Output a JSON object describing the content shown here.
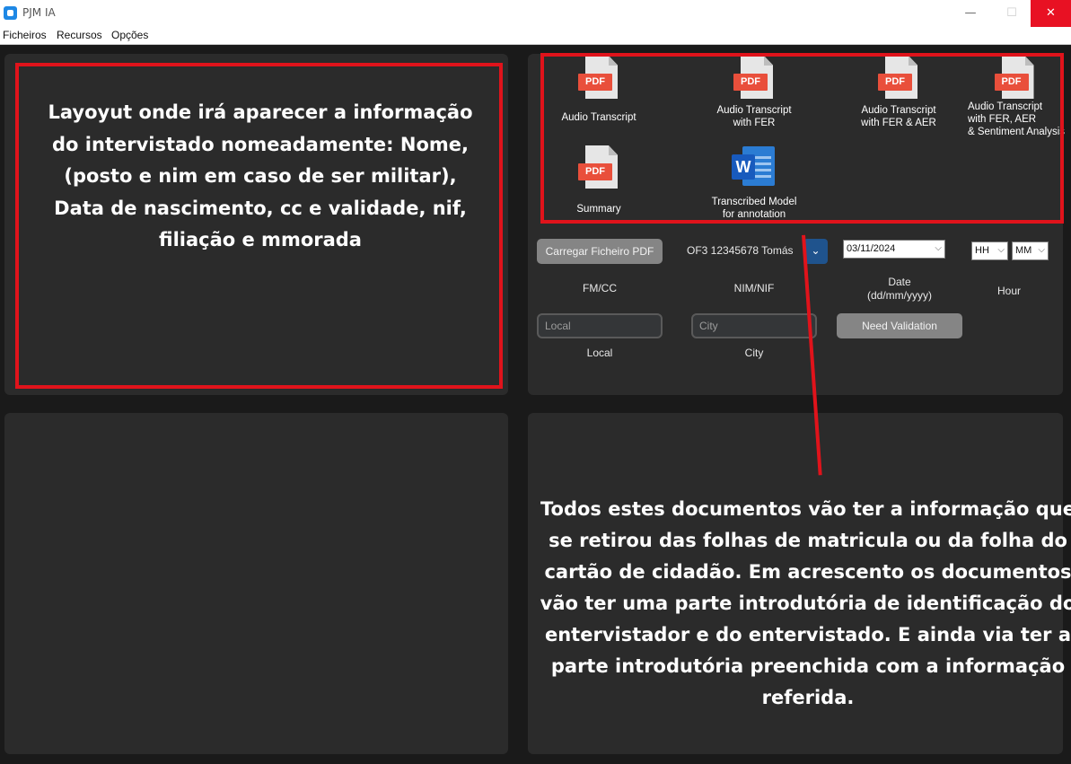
{
  "window": {
    "title": "PJM IA",
    "minimize": "—",
    "maximize": "☐",
    "close": "✕"
  },
  "menu": [
    "Ficheiros",
    "Recursos",
    "Opções"
  ],
  "annotations": {
    "left_box": "Layoyut onde irá aparecer a informação do intervistado nomeadamente: Nome, (posto e nim em caso de ser militar), Data de nascimento, cc e validade, nif, filiação e mmorada",
    "bottom_note": "Todos estes documentos vão ter a informação que se retirou das folhas de matricula ou da folha do cartão de cidadão. Em acrescento os documentos vão ter uma parte introdutória de identificação do entervistador e do entervistado. E ainda via ter a parte introdutória preenchida com a informação referida."
  },
  "documents": [
    {
      "icon": "pdf-icon",
      "badge": "PDF",
      "label": "Audio Transcript"
    },
    {
      "icon": "pdf-icon",
      "badge": "PDF",
      "label": "Audio Transcript\nwith FER"
    },
    {
      "icon": "pdf-icon",
      "badge": "PDF",
      "label": "Audio Transcript\nwith FER & AER"
    },
    {
      "icon": "pdf-icon",
      "badge": "PDF",
      "label": "Audio Transcript\nwith FER, AER\n& Sentiment Analysis"
    },
    {
      "icon": "pdf-icon",
      "badge": "PDF",
      "label": "Summary"
    },
    {
      "icon": "word-icon",
      "badge": "W",
      "label": "Transcribed Model\nfor annotation"
    }
  ],
  "form": {
    "load_pdf_button": "Carregar Ficheiro PDF",
    "fm_cc_label": "FM/CC",
    "nim_value": "OF3 12345678 Tomás",
    "nim_label": "NIM/NIF",
    "date_value": "03/11/2024",
    "date_label": "Date\n(dd/mm/yyyy)",
    "hour_value": "HH",
    "minute_value": "MM",
    "hour_label": "Hour",
    "local_placeholder": "Local",
    "local_label": "Local",
    "city_placeholder": "City",
    "city_label": "City",
    "validation_button": "Need Validation"
  },
  "colors": {
    "accent": "#1f538d",
    "annotation_red": "#e0131b",
    "panel": "#2b2b2b",
    "background": "#1a1a1a"
  }
}
